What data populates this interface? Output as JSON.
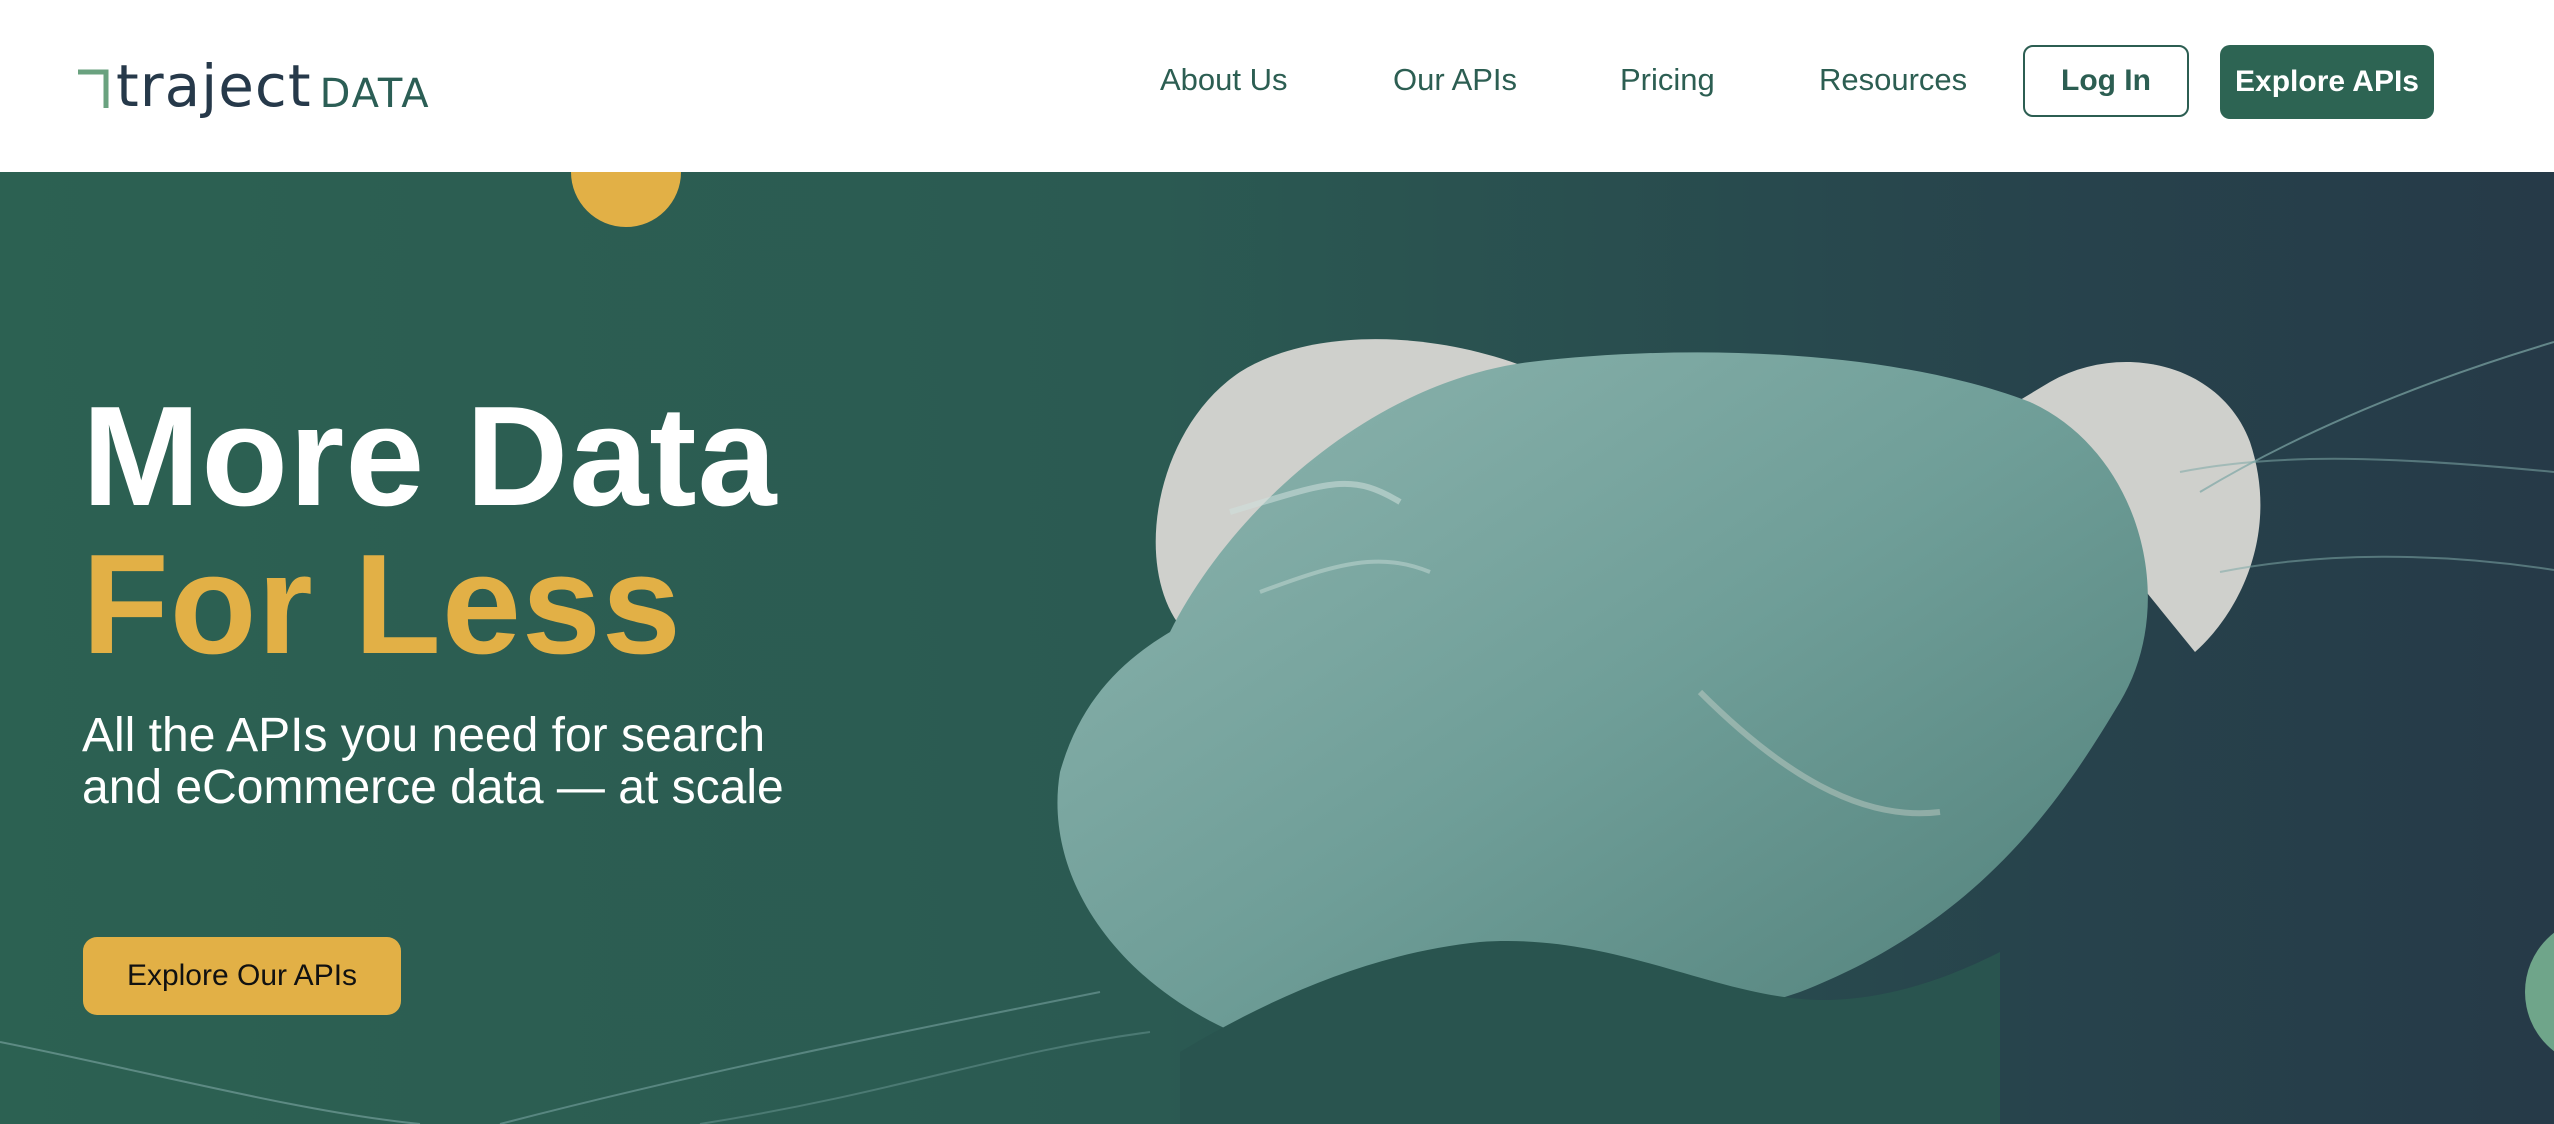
{
  "logo": {
    "brand": "traject",
    "suffix": "DATA"
  },
  "nav": {
    "about": "About Us",
    "apis": "Our APIs",
    "pricing": "Pricing",
    "resources": "Resources",
    "login": "Log In",
    "explore": "Explore APIs"
  },
  "hero": {
    "headline_line1": "More Data",
    "headline_line2": "For Less",
    "subtitle": "All the APIs you need for search and eCommerce data — at scale",
    "cta": "Explore Our APIs"
  },
  "colors": {
    "brand_green": "#2d6453",
    "accent_gold": "#e2b046",
    "navy": "#26394a"
  },
  "icons": [
    "logo-corner-mark-icon"
  ]
}
